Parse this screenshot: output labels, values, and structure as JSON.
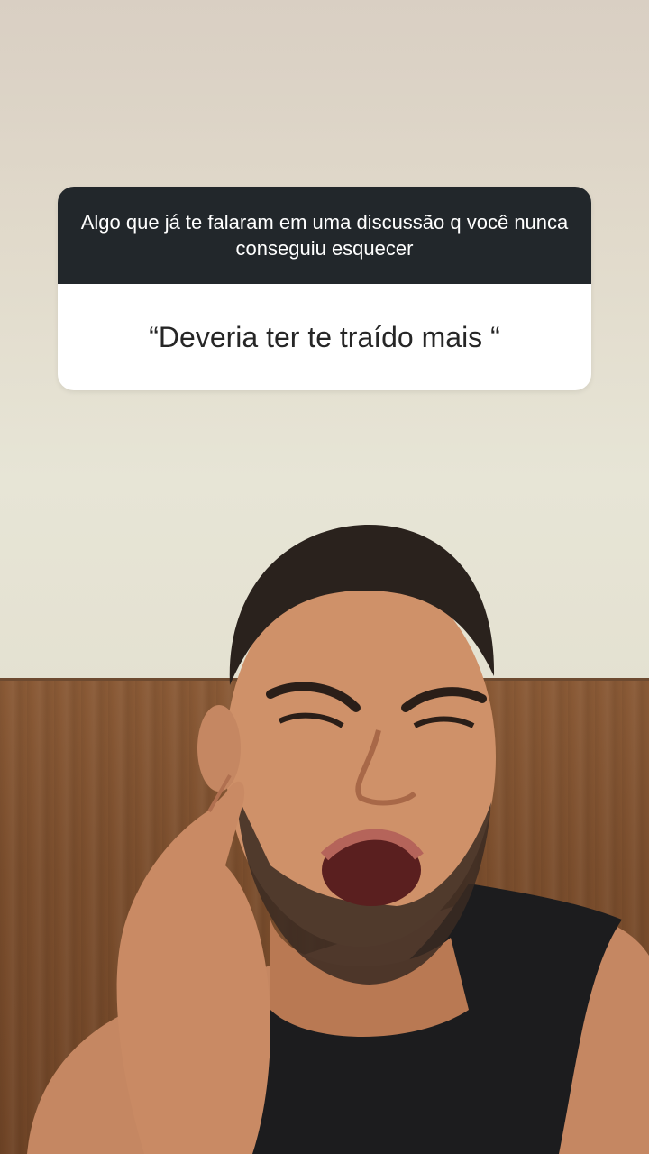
{
  "question_sticker": {
    "question": "Algo que já te falaram em uma discussão q você nunca conseguiu esquecer",
    "answer": "“Deveria ter te traído mais “"
  },
  "background": {
    "description_colors": {
      "wall": "#e2dccd",
      "wood": "#7b4e2d",
      "skin": "#c98a64",
      "shirt": "#1d1d1f"
    }
  }
}
